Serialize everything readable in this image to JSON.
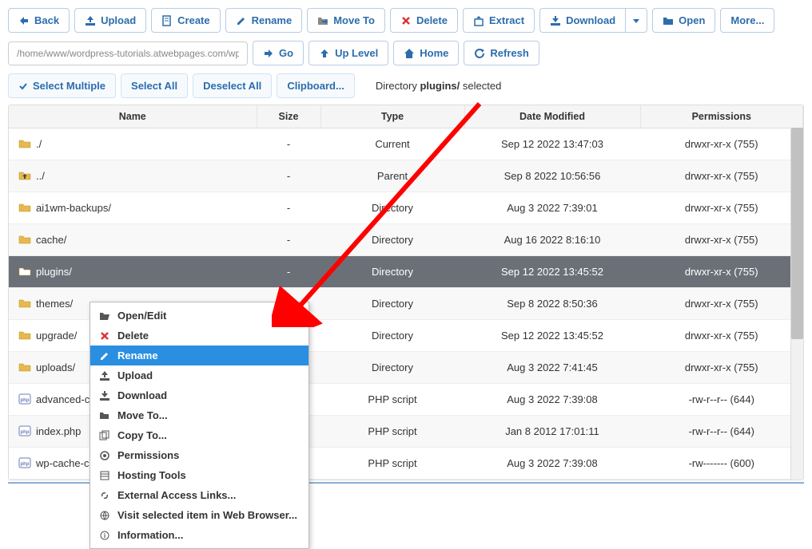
{
  "toolbar": {
    "back": "Back",
    "upload": "Upload",
    "create": "Create",
    "rename": "Rename",
    "move_to": "Move To",
    "delete": "Delete",
    "extract": "Extract",
    "download": "Download",
    "open": "Open",
    "more": "More..."
  },
  "path": {
    "value": "/home/www/wordpress-tutorials.atwebpages.com/wp-con",
    "go": "Go",
    "up_level": "Up Level",
    "home": "Home",
    "refresh": "Refresh"
  },
  "selection": {
    "select_multiple": "Select Multiple",
    "select_all": "Select All",
    "deselect_all": "Deselect All",
    "clipboard": "Clipboard...",
    "status_prefix": "Directory ",
    "status_bold": "plugins/",
    "status_suffix": " selected"
  },
  "headers": [
    "Name",
    "Size",
    "Type",
    "Date Modified",
    "Permissions"
  ],
  "rows": [
    {
      "icon": "folder",
      "name": "./",
      "size": "-",
      "type": "Current",
      "date": "Sep 12 2022 13:47:03",
      "perm": "drwxr-xr-x (755)",
      "alt": false
    },
    {
      "icon": "up",
      "name": "../",
      "size": "-",
      "type": "Parent",
      "date": "Sep 8 2022 10:56:56",
      "perm": "drwxr-xr-x (755)",
      "alt": true
    },
    {
      "icon": "folder",
      "name": "ai1wm-backups/",
      "size": "-",
      "type": "Directory",
      "date": "Aug 3 2022 7:39:01",
      "perm": "drwxr-xr-x (755)",
      "alt": false
    },
    {
      "icon": "folder",
      "name": "cache/",
      "size": "-",
      "type": "Directory",
      "date": "Aug 16 2022 8:16:10",
      "perm": "drwxr-xr-x (755)",
      "alt": true
    },
    {
      "icon": "folder",
      "name": "plugins/",
      "size": "-",
      "type": "Directory",
      "date": "Sep 12 2022 13:45:52",
      "perm": "drwxr-xr-x (755)",
      "selected": true
    },
    {
      "icon": "folder",
      "name": "themes/",
      "size": "",
      "type": "Directory",
      "date": "Sep 8 2022 8:50:36",
      "perm": "drwxr-xr-x (755)",
      "alt": true
    },
    {
      "icon": "folder",
      "name": "upgrade/",
      "size": "",
      "type": "Directory",
      "date": "Sep 12 2022 13:45:52",
      "perm": "drwxr-xr-x (755)",
      "alt": false
    },
    {
      "icon": "folder",
      "name": "uploads/",
      "size": "",
      "type": "Directory",
      "date": "Aug 3 2022 7:41:45",
      "perm": "drwxr-xr-x (755)",
      "alt": true
    },
    {
      "icon": "php",
      "name": "advanced-ca",
      "size": "",
      "type": "PHP script",
      "date": "Aug 3 2022 7:39:08",
      "perm": "-rw-r--r-- (644)",
      "alt": false
    },
    {
      "icon": "php",
      "name": "index.php",
      "size": "",
      "type": "PHP script",
      "date": "Jan 8 2012 17:01:11",
      "perm": "-rw-r--r-- (644)",
      "alt": true
    },
    {
      "icon": "php",
      "name": "wp-cache-co",
      "size": "",
      "type": "PHP script",
      "date": "Aug 3 2022 7:39:08",
      "perm": "-rw------- (600)",
      "alt": false
    }
  ],
  "context_menu": {
    "items": [
      {
        "icon": "open",
        "label": "Open/Edit"
      },
      {
        "icon": "delete",
        "label": "Delete"
      },
      {
        "icon": "rename",
        "label": "Rename",
        "highlighted": true
      },
      {
        "icon": "upload",
        "label": "Upload"
      },
      {
        "icon": "download",
        "label": "Download"
      },
      {
        "icon": "moveto",
        "label": "Move To..."
      },
      {
        "icon": "copyto",
        "label": "Copy To..."
      },
      {
        "icon": "perm",
        "label": "Permissions"
      },
      {
        "icon": "hosting",
        "label": "Hosting Tools"
      },
      {
        "icon": "link",
        "label": "External Access Links..."
      },
      {
        "icon": "web",
        "label": "Visit selected item in Web Browser..."
      },
      {
        "icon": "info",
        "label": "Information..."
      }
    ]
  },
  "colors": {
    "btn_border": "#b8cce4",
    "btn_text": "#2b6dad",
    "selected_row": "#6b7078",
    "ctx_highlight": "#2a8fe0",
    "arrow": "#ff0000"
  }
}
